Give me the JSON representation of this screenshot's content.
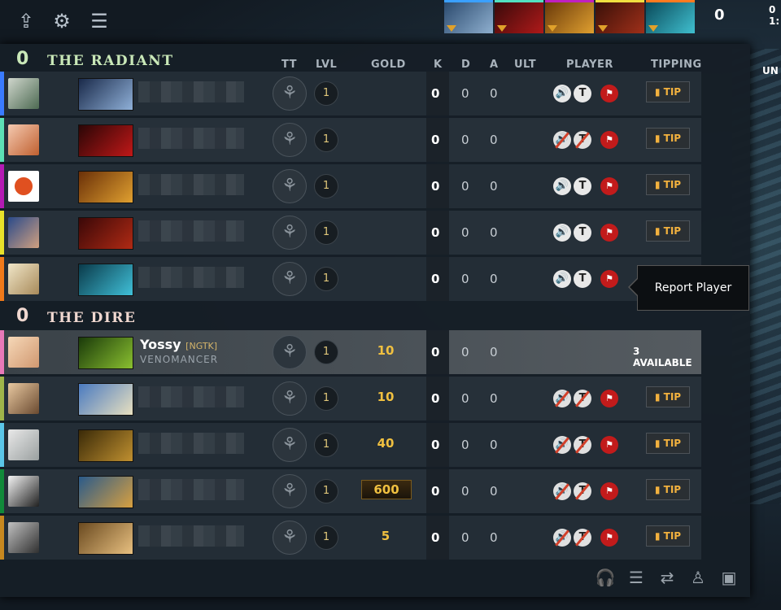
{
  "top": {
    "score": "0",
    "edge_text": "0",
    "edge_time": "1:",
    "edge_un": "UN",
    "heroes": [
      {
        "name": "Drow Ranger",
        "color": "#3aa0ff"
      },
      {
        "name": "Bloodseeker",
        "color": "#52e0c0"
      },
      {
        "name": "Huskar",
        "color": "#c020c0"
      },
      {
        "name": "Shadow Fiend",
        "color": "#f0e040"
      },
      {
        "name": "Morphling",
        "color": "#ff7a20"
      }
    ]
  },
  "columns": {
    "tt": "TT",
    "lvl": "LVL",
    "gold": "GOLD",
    "k": "K",
    "d": "D",
    "a": "A",
    "ult": "ULT",
    "player": "PLAYER",
    "tipping": "TIPPING"
  },
  "radiant": {
    "score": "0",
    "name": "THE RADIANT",
    "players": [
      {
        "level": "1",
        "gold": "",
        "k": "0",
        "d": "0",
        "a": "0",
        "tip": "TIP",
        "bar_color": "#3a7bff",
        "hero": "Drow Ranger"
      },
      {
        "level": "1",
        "gold": "",
        "k": "0",
        "d": "0",
        "a": "0",
        "tip": "TIP",
        "bar_color": "#5de0b5",
        "hero": "Bloodseeker"
      },
      {
        "level": "1",
        "gold": "",
        "k": "0",
        "d": "0",
        "a": "0",
        "tip": "TIP",
        "bar_color": "#b41bb4",
        "hero": "Huskar"
      },
      {
        "level": "1",
        "gold": "",
        "k": "0",
        "d": "0",
        "a": "0",
        "tip": "TIP",
        "bar_color": "#e8e22a",
        "hero": "Shadow Fiend"
      },
      {
        "level": "1",
        "gold": "",
        "k": "0",
        "d": "0",
        "a": "0",
        "tip": "TIP",
        "bar_color": "#f07a1a",
        "hero": "Morphling"
      }
    ]
  },
  "dire": {
    "score": "0",
    "name": "THE DIRE",
    "players": [
      {
        "name": "Yossy",
        "tag": "[NGTK]",
        "hero": "VENOMANCER",
        "level": "1",
        "gold": "10",
        "k": "0",
        "d": "0",
        "a": "0",
        "tip": "3 AVAILABLE",
        "bar_color": "#e879b8"
      },
      {
        "level": "1",
        "gold": "10",
        "k": "0",
        "d": "0",
        "a": "0",
        "tip": "TIP",
        "bar_color": "#9fb54a",
        "hero": "Crystal Maiden"
      },
      {
        "level": "1",
        "gold": "40",
        "k": "0",
        "d": "0",
        "a": "0",
        "tip": "TIP",
        "bar_color": "#5bc6e8",
        "hero": "Sand King"
      },
      {
        "level": "1",
        "gold": "600",
        "k": "0",
        "d": "0",
        "a": "0",
        "tip": "TIP",
        "bar_color": "#118a3a",
        "hero": "Pangolier"
      },
      {
        "level": "1",
        "gold": "5",
        "k": "0",
        "d": "0",
        "a": "0",
        "tip": "TIP",
        "bar_color": "#c7881f",
        "hero": "Keeper of the Light"
      }
    ]
  },
  "tooltip": "Report Player"
}
